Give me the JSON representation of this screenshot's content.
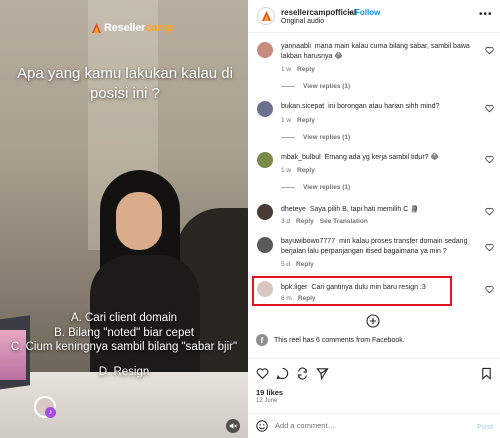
{
  "reel": {
    "logo_main": "Reseller",
    "logo_accent": "camp",
    "question": "Apa yang kamu lakukan kalau di posisi ini ?",
    "options": [
      "A. Cari client domain",
      "B. Bilang \"noted\" biar cepet",
      "C. Cium keningnya sambil bilang \"sabar bjir\"",
      "D. Resign"
    ]
  },
  "header": {
    "username": "resellercampofficial",
    "separator": "•",
    "follow_label": "Follow",
    "audio_label": "Original audio"
  },
  "comments": [
    {
      "username": "yannaabli",
      "text": "mana main kalau cuma bilang sabar, sambil bawa lakban harusnya 😂",
      "time": "1 w",
      "reply_label": "Reply",
      "view_replies": "View replies (1)",
      "avatar_color": "#c98b7d"
    },
    {
      "username": "bukan.sicepat",
      "text": "ini borongan atau harian sihh mind?",
      "time": "1 w",
      "reply_label": "Reply",
      "view_replies": "View replies (1)",
      "avatar_color": "#6d6f8f"
    },
    {
      "username": "mbak_bulbul",
      "text": "Emang ada yg kerja sambil tidur? 😂",
      "time": "1 w",
      "reply_label": "Reply",
      "view_replies": "View replies (1)",
      "avatar_color": "#7a8a4a"
    },
    {
      "username": "dheteye",
      "text": "Saya pilih B, tapi hati memilih C 🗿",
      "time": "3 d",
      "reply_label": "Reply",
      "translation_label": "See Translation",
      "avatar_color": "#4a3b35"
    },
    {
      "username": "bayuwibowo7777",
      "text": "min kalau proses transfer domain sedang berjalan lalu perpanjangan itised bagaimana ya min ?",
      "time": "5 d",
      "reply_label": "Reply",
      "avatar_color": "#5a5a5a"
    },
    {
      "username": "bpk.liger",
      "text": "Cari gantinya dulu min baru resign :3",
      "time": "6 m",
      "reply_label": "Reply",
      "avatar_color": "#d8c6c0"
    }
  ],
  "facebook_note": "This reel has 6 comments from Facebook.",
  "likes": "19 likes",
  "date": "12 June",
  "add_comment": {
    "placeholder": "Add a comment…",
    "post_label": "Post"
  },
  "colors": {
    "accent_blue": "#0095f6",
    "highlight_red": "#e0141e",
    "logo_orange": "#f5a623"
  }
}
